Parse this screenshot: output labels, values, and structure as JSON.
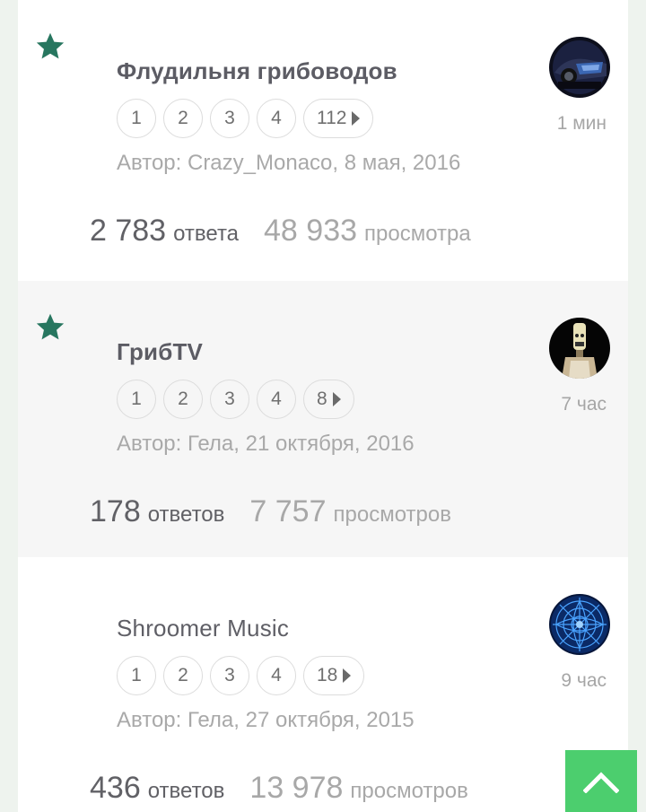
{
  "topics": [
    {
      "title": "Флудильня грибоводов",
      "pinned": true,
      "pages": [
        "1",
        "2",
        "3",
        "4",
        "112"
      ],
      "author": "Автор: Crazy_Monaco, 8 мая, 2016",
      "replies_count": "2 783",
      "replies_label": "ответа",
      "views_count": "48 933",
      "views_label": "просмотра",
      "last_post_time": "1 мин"
    },
    {
      "title": "ГрибTV",
      "pinned": true,
      "pages": [
        "1",
        "2",
        "3",
        "4",
        "8"
      ],
      "author": "Автор: Гела, 21 октября, 2016",
      "replies_count": "178",
      "replies_label": "ответов",
      "views_count": "7 757",
      "views_label": "просмотров",
      "last_post_time": "7 час"
    },
    {
      "title": "Shroomer Music",
      "pinned": false,
      "pages": [
        "1",
        "2",
        "3",
        "4",
        "18"
      ],
      "author": "Автор: Гела, 27 октября, 2015",
      "replies_count": "436",
      "replies_label": "ответов",
      "views_count": "13 978",
      "views_label": "просмотров",
      "last_post_time": "9 час"
    }
  ],
  "colors": {
    "star": "#27765f",
    "scroll_top_bg": "#4cce6e",
    "page_bg": "#eef3ee"
  },
  "icons": {
    "pin": "star-icon",
    "next_page": "caret-right-icon",
    "scroll_top": "chevron-up-icon"
  }
}
